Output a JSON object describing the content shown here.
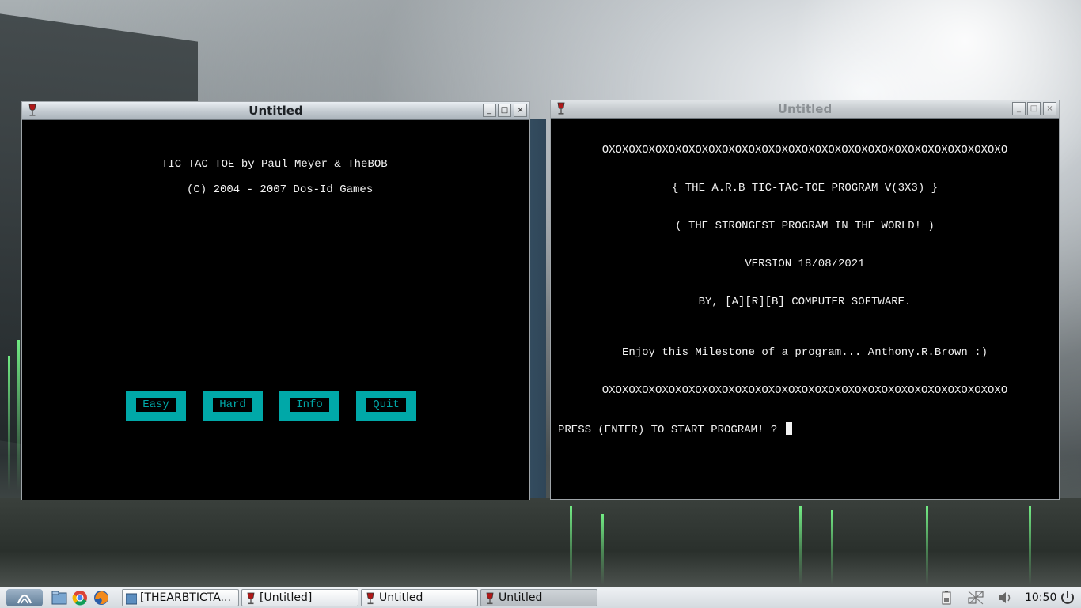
{
  "windows": [
    {
      "title": "Untitled",
      "state": "active",
      "lines": [
        "TIC TAC TOE by Paul Meyer & TheBOB",
        "(C) 2004 - 2007 Dos-Id Games"
      ],
      "buttons": [
        "Easy",
        "Hard",
        "Info",
        "Quit"
      ]
    },
    {
      "title": "Untitled",
      "state": "inactive",
      "lines": [
        "OXOXOXOXOXOXOXOXOXOXOXOXOXOXOXOXOXOXOXOXOXOXOXOXOXOXOXOXOXOXO",
        "{ THE A.R.B TIC-TAC-TOE PROGRAM V(3X3) }",
        "( THE STRONGEST PROGRAM IN THE WORLD! )",
        "VERSION 18/08/2021",
        "BY, [A][R][B] COMPUTER SOFTWARE.",
        "Enjoy this Milestone of a program... Anthony.R.Brown :)",
        "OXOXOXOXOXOXOXOXOXOXOXOXOXOXOXOXOXOXOXOXOXOXOXOXOXOXOXOXOXOXO"
      ],
      "prompt": "PRESS (ENTER) TO START PROGRAM! ? "
    }
  ],
  "window_controls": {
    "minimize": "_",
    "maximize": "□",
    "close": "×"
  },
  "taskbar": {
    "items": [
      {
        "label": "[THEARBTICTA...",
        "icon": "folder-icon",
        "active": false
      },
      {
        "label": "[Untitled]",
        "icon": "wine-icon",
        "active": false
      },
      {
        "label": "Untitled",
        "icon": "wine-icon",
        "active": false
      },
      {
        "label": "Untitled",
        "icon": "wine-icon",
        "active": true
      }
    ],
    "quick_launch": [
      "file-manager-icon",
      "chrome-icon",
      "firefox-icon"
    ],
    "tray": [
      "battery-icon",
      "network-icon",
      "volume-icon",
      "power-icon"
    ],
    "clock": "10:50"
  },
  "colors": {
    "cyan": "#00a8a8",
    "terminal_bg": "#000000",
    "terminal_fg": "#f2f2f2"
  }
}
